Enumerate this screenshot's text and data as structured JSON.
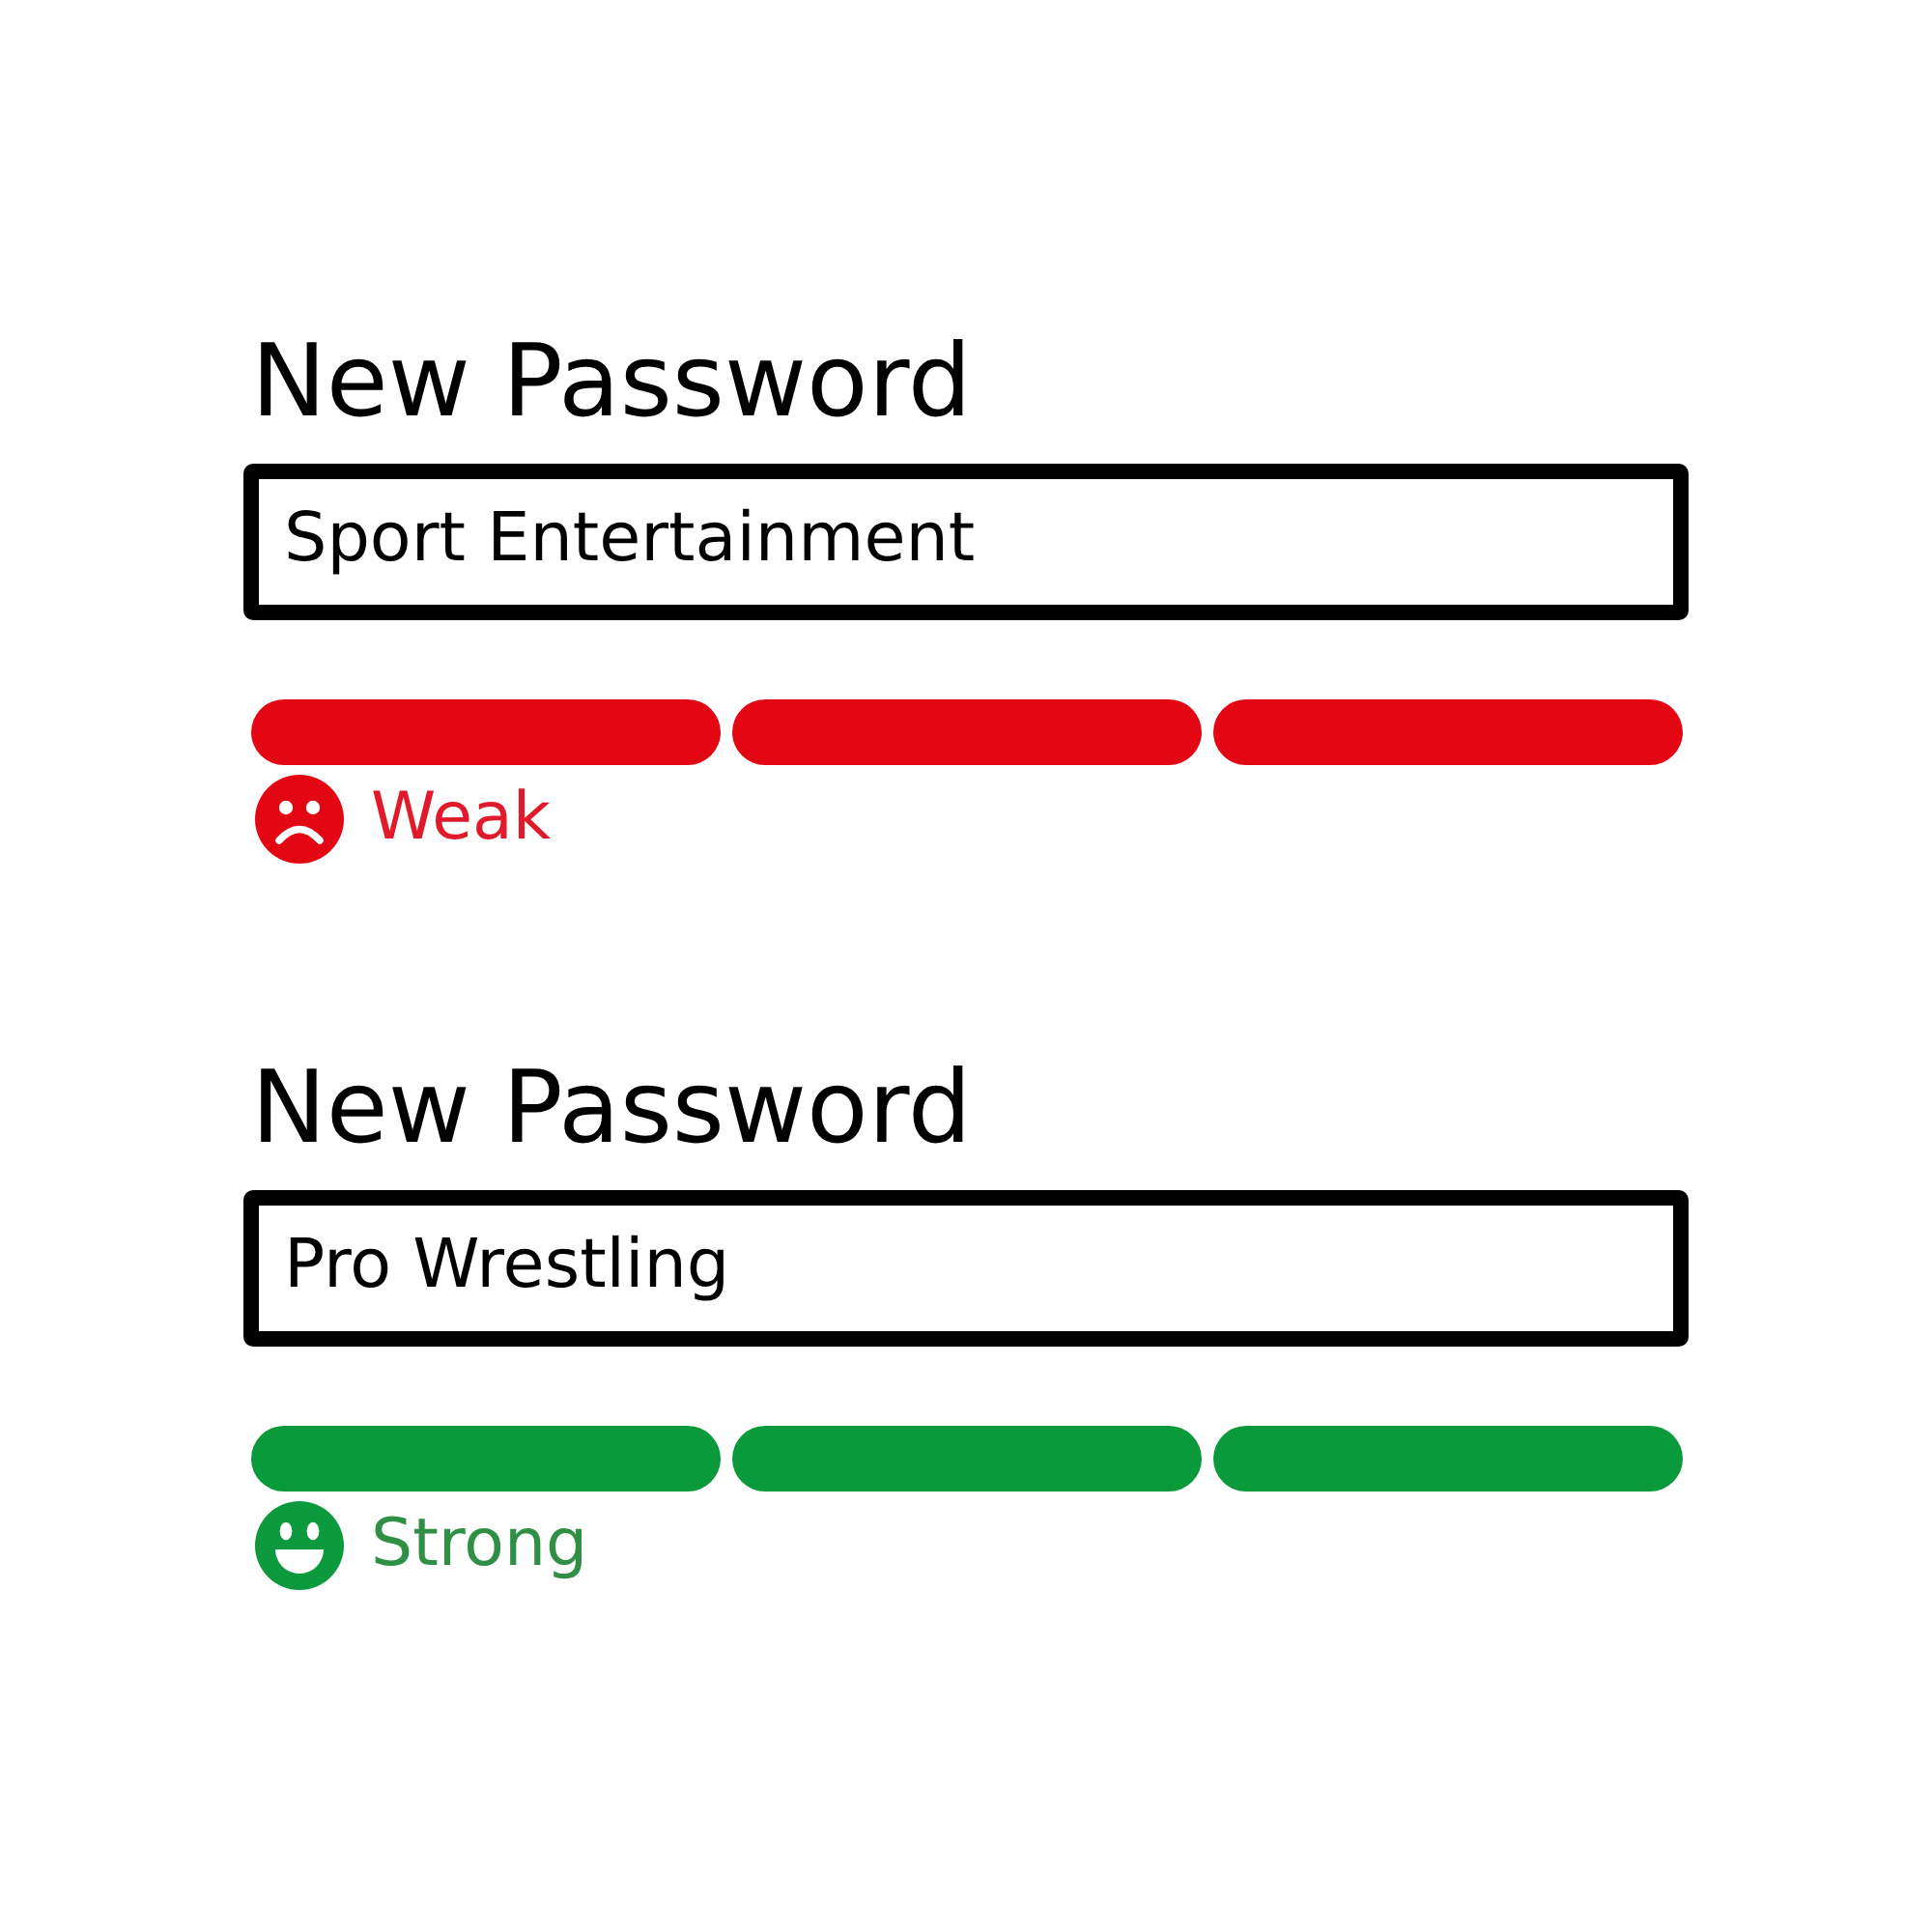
{
  "fields": [
    {
      "label": "New Password",
      "value": "Sport Entertainment",
      "strength": {
        "kind": "weak",
        "label": "Weak",
        "segments": [
          {
            "filled": true
          },
          {
            "filled": true
          },
          {
            "filled": true
          }
        ]
      }
    },
    {
      "label": "New Password",
      "value": "Pro Wrestling",
      "strength": {
        "kind": "strong",
        "label": "Strong",
        "segments": [
          {
            "filled": true
          },
          {
            "filled": true
          },
          {
            "filled": true
          }
        ]
      }
    }
  ]
}
